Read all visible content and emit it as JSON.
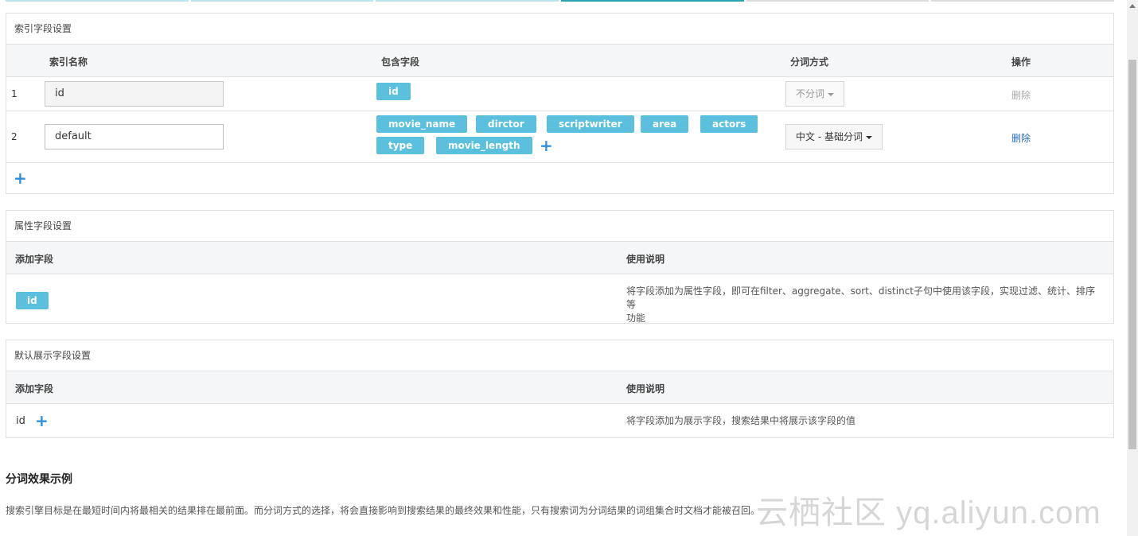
{
  "index_panel": {
    "title": "索引字段设置",
    "headers": {
      "name": "索引名称",
      "fields": "包含字段",
      "tokenizer": "分词方式",
      "action": "操作"
    },
    "rows": [
      {
        "num": "1",
        "name": "id",
        "fields": [
          "id"
        ],
        "tokenizer": "不分词",
        "action": "删除"
      },
      {
        "num": "2",
        "name": "default",
        "fields": [
          "movie_name",
          "dirctor",
          "scriptwriter",
          "area",
          "actors",
          "type",
          "movie_length"
        ],
        "tokenizer": "中文 - 基础分词",
        "action": "删除"
      }
    ]
  },
  "attr_panel": {
    "title": "属性字段设置",
    "headers": {
      "field": "添加字段",
      "desc": "使用说明"
    },
    "field_tag": "id",
    "desc_line1": "将字段添加为属性字段，即可在filter、aggregate、sort、distinct子句中使用该字段，实现过滤、统计、排序等",
    "desc_line2": "功能"
  },
  "display_panel": {
    "title": "默认展示字段设置",
    "headers": {
      "field": "添加字段",
      "desc": "使用说明"
    },
    "field": "id",
    "desc": "将字段添加为展示字段，搜索结果中将展示该字段的值"
  },
  "section": {
    "title": "分词效果示例",
    "body": "搜索引擎目标是在最短时间内将最相关的结果排在最前面。而分词方式的选择，将会直接影响到搜索结果的最终效果和性能，只有搜索词为分词结果的词组集合时文档才能被召回。"
  },
  "watermark": "云栖社区 yq.aliyun.com",
  "colors": {
    "tag": "#5bc0de",
    "link": "#2a6db7",
    "plus": "#2f8fdc"
  }
}
